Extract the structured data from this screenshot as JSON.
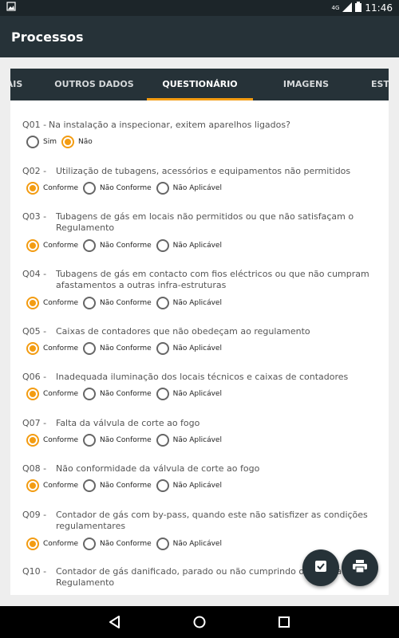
{
  "status_bar": {
    "network": "4G",
    "time": "11:46"
  },
  "app_bar": {
    "title": "Processos"
  },
  "tabs": [
    {
      "label": "AIS"
    },
    {
      "label": "OUTROS DADOS"
    },
    {
      "label": "QUESTIONÁRIO"
    },
    {
      "label": "IMAGENS"
    },
    {
      "label": "EST"
    }
  ],
  "options": {
    "conforme": "Conforme",
    "nao_conforme": "Não Conforme",
    "nao_aplicavel": "Não Aplicável",
    "sim": "Sim",
    "nao": "Não"
  },
  "questions": [
    {
      "id": "Q01 -",
      "text": "Na instalação a inspecionar, exitem aparelhos ligados?",
      "selected": "Não"
    },
    {
      "id": "Q02 -",
      "text": "Utilização de tubagens, acessórios e equipamentos não permitidos",
      "selected": "Conforme"
    },
    {
      "id": "Q03 -",
      "text": "Tubagens de gás em locais não permitidos ou que não satisfaçam o Regulamento",
      "selected": "Conforme"
    },
    {
      "id": "Q04 -",
      "text": "Tubagens de gás em contacto com fios eléctricos ou que não cumpram afastamentos a outras infra-estruturas",
      "selected": "Conforme"
    },
    {
      "id": "Q05 -",
      "text": "Caixas de contadores que não obedeçam ao regulamento",
      "selected": "Conforme"
    },
    {
      "id": "Q06 -",
      "text": "Inadequada iluminação dos locais técnicos e caixas de contadores",
      "selected": "Conforme"
    },
    {
      "id": "Q07 -",
      "text": "Falta da válvula de corte ao fogo",
      "selected": "Conforme"
    },
    {
      "id": "Q08 -",
      "text": "Não conformidade da válvula de corte ao fogo",
      "selected": "Conforme"
    },
    {
      "id": "Q09 -",
      "text": "Contador de gás com by-pass, quando este não satisfizer as condições regulamentares",
      "selected": "Conforme"
    },
    {
      "id": "Q10 -",
      "text": "Contador de gás danificado, parado ou não cumprindo o estipulado no Regulamento",
      "selected": ""
    }
  ],
  "fabs": {
    "check_icon": "check-box-icon",
    "print_icon": "print-icon"
  },
  "colors": {
    "accent": "#f39c12",
    "primary": "#263238"
  }
}
